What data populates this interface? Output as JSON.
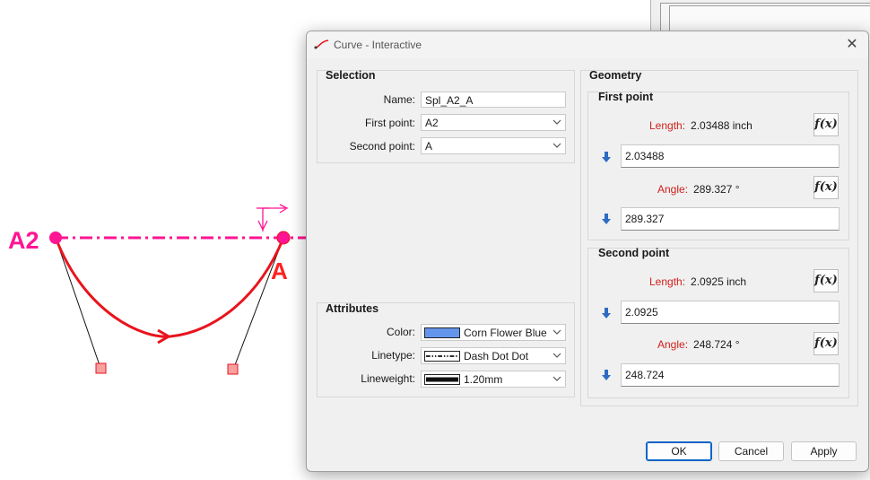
{
  "canvas": {
    "point_labels": {
      "a2": "A2",
      "a": "A"
    }
  },
  "dialog": {
    "title": "Curve - Interactive",
    "close_glyph": "✕",
    "selection": {
      "title": "Selection",
      "name_label": "Name:",
      "name_value": "Spl_A2_A",
      "first_point_label": "First point:",
      "first_point_value": "A2",
      "second_point_label": "Second point:",
      "second_point_value": "A"
    },
    "attributes": {
      "title": "Attributes",
      "color_label": "Color:",
      "color_value": "Corn Flower Blue",
      "color_hex": "#6495ed",
      "linetype_label": "Linetype:",
      "linetype_value": "Dash Dot Dot",
      "lineweight_label": "Lineweight:",
      "lineweight_value": "1.20mm"
    },
    "geometry": {
      "title": "Geometry",
      "first_point": {
        "title": "First point",
        "length_label": "Length:",
        "length_value": "2.03488 inch",
        "length_input": "2.03488",
        "angle_label": "Angle:",
        "angle_value": "289.327 °",
        "angle_input": "289.327"
      },
      "second_point": {
        "title": "Second point",
        "length_label": "Length:",
        "length_value": "2.0925 inch",
        "length_input": "2.0925",
        "angle_label": "Angle:",
        "angle_value": "248.724 °",
        "angle_input": "248.724"
      },
      "fx_label": "f(x)"
    },
    "buttons": {
      "ok": "OK",
      "cancel": "Cancel",
      "apply": "Apply"
    }
  },
  "colors": {
    "curve": "#e8141c",
    "axis": "#ff1493",
    "label_error": "#d0201c",
    "accent": "#0a64c8",
    "arrow_icon": "#2e6bc4"
  },
  "icons": [
    "curve-icon",
    "close-icon",
    "chevron-down-icon",
    "arrow-down-icon",
    "function-icon"
  ]
}
